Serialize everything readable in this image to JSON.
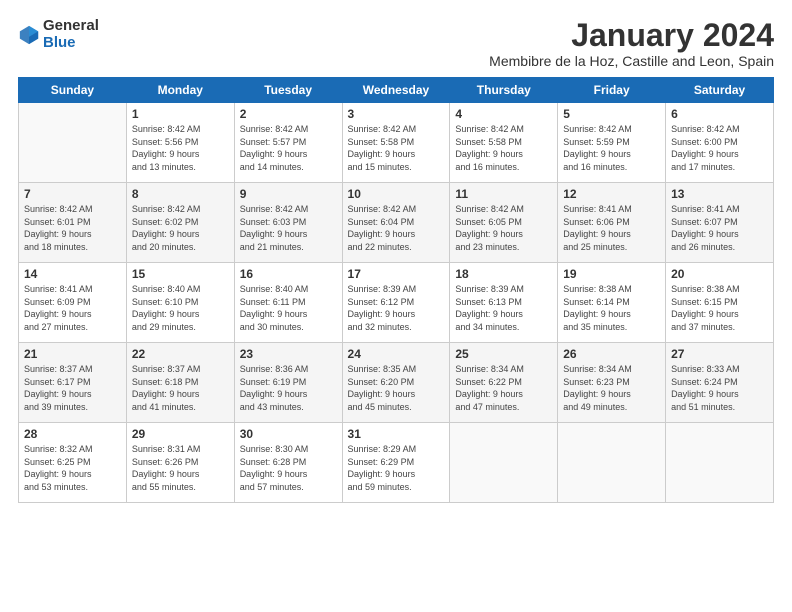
{
  "logo": {
    "general": "General",
    "blue": "Blue"
  },
  "title": "January 2024",
  "location": "Membibre de la Hoz, Castille and Leon, Spain",
  "headers": [
    "Sunday",
    "Monday",
    "Tuesday",
    "Wednesday",
    "Thursday",
    "Friday",
    "Saturday"
  ],
  "weeks": [
    [
      {
        "day": "",
        "text": ""
      },
      {
        "day": "1",
        "text": "Sunrise: 8:42 AM\nSunset: 5:56 PM\nDaylight: 9 hours\nand 13 minutes."
      },
      {
        "day": "2",
        "text": "Sunrise: 8:42 AM\nSunset: 5:57 PM\nDaylight: 9 hours\nand 14 minutes."
      },
      {
        "day": "3",
        "text": "Sunrise: 8:42 AM\nSunset: 5:58 PM\nDaylight: 9 hours\nand 15 minutes."
      },
      {
        "day": "4",
        "text": "Sunrise: 8:42 AM\nSunset: 5:58 PM\nDaylight: 9 hours\nand 16 minutes."
      },
      {
        "day": "5",
        "text": "Sunrise: 8:42 AM\nSunset: 5:59 PM\nDaylight: 9 hours\nand 16 minutes."
      },
      {
        "day": "6",
        "text": "Sunrise: 8:42 AM\nSunset: 6:00 PM\nDaylight: 9 hours\nand 17 minutes."
      }
    ],
    [
      {
        "day": "7",
        "text": "Sunrise: 8:42 AM\nSunset: 6:01 PM\nDaylight: 9 hours\nand 18 minutes."
      },
      {
        "day": "8",
        "text": "Sunrise: 8:42 AM\nSunset: 6:02 PM\nDaylight: 9 hours\nand 20 minutes."
      },
      {
        "day": "9",
        "text": "Sunrise: 8:42 AM\nSunset: 6:03 PM\nDaylight: 9 hours\nand 21 minutes."
      },
      {
        "day": "10",
        "text": "Sunrise: 8:42 AM\nSunset: 6:04 PM\nDaylight: 9 hours\nand 22 minutes."
      },
      {
        "day": "11",
        "text": "Sunrise: 8:42 AM\nSunset: 6:05 PM\nDaylight: 9 hours\nand 23 minutes."
      },
      {
        "day": "12",
        "text": "Sunrise: 8:41 AM\nSunset: 6:06 PM\nDaylight: 9 hours\nand 25 minutes."
      },
      {
        "day": "13",
        "text": "Sunrise: 8:41 AM\nSunset: 6:07 PM\nDaylight: 9 hours\nand 26 minutes."
      }
    ],
    [
      {
        "day": "14",
        "text": "Sunrise: 8:41 AM\nSunset: 6:09 PM\nDaylight: 9 hours\nand 27 minutes."
      },
      {
        "day": "15",
        "text": "Sunrise: 8:40 AM\nSunset: 6:10 PM\nDaylight: 9 hours\nand 29 minutes."
      },
      {
        "day": "16",
        "text": "Sunrise: 8:40 AM\nSunset: 6:11 PM\nDaylight: 9 hours\nand 30 minutes."
      },
      {
        "day": "17",
        "text": "Sunrise: 8:39 AM\nSunset: 6:12 PM\nDaylight: 9 hours\nand 32 minutes."
      },
      {
        "day": "18",
        "text": "Sunrise: 8:39 AM\nSunset: 6:13 PM\nDaylight: 9 hours\nand 34 minutes."
      },
      {
        "day": "19",
        "text": "Sunrise: 8:38 AM\nSunset: 6:14 PM\nDaylight: 9 hours\nand 35 minutes."
      },
      {
        "day": "20",
        "text": "Sunrise: 8:38 AM\nSunset: 6:15 PM\nDaylight: 9 hours\nand 37 minutes."
      }
    ],
    [
      {
        "day": "21",
        "text": "Sunrise: 8:37 AM\nSunset: 6:17 PM\nDaylight: 9 hours\nand 39 minutes."
      },
      {
        "day": "22",
        "text": "Sunrise: 8:37 AM\nSunset: 6:18 PM\nDaylight: 9 hours\nand 41 minutes."
      },
      {
        "day": "23",
        "text": "Sunrise: 8:36 AM\nSunset: 6:19 PM\nDaylight: 9 hours\nand 43 minutes."
      },
      {
        "day": "24",
        "text": "Sunrise: 8:35 AM\nSunset: 6:20 PM\nDaylight: 9 hours\nand 45 minutes."
      },
      {
        "day": "25",
        "text": "Sunrise: 8:34 AM\nSunset: 6:22 PM\nDaylight: 9 hours\nand 47 minutes."
      },
      {
        "day": "26",
        "text": "Sunrise: 8:34 AM\nSunset: 6:23 PM\nDaylight: 9 hours\nand 49 minutes."
      },
      {
        "day": "27",
        "text": "Sunrise: 8:33 AM\nSunset: 6:24 PM\nDaylight: 9 hours\nand 51 minutes."
      }
    ],
    [
      {
        "day": "28",
        "text": "Sunrise: 8:32 AM\nSunset: 6:25 PM\nDaylight: 9 hours\nand 53 minutes."
      },
      {
        "day": "29",
        "text": "Sunrise: 8:31 AM\nSunset: 6:26 PM\nDaylight: 9 hours\nand 55 minutes."
      },
      {
        "day": "30",
        "text": "Sunrise: 8:30 AM\nSunset: 6:28 PM\nDaylight: 9 hours\nand 57 minutes."
      },
      {
        "day": "31",
        "text": "Sunrise: 8:29 AM\nSunset: 6:29 PM\nDaylight: 9 hours\nand 59 minutes."
      },
      {
        "day": "",
        "text": ""
      },
      {
        "day": "",
        "text": ""
      },
      {
        "day": "",
        "text": ""
      }
    ]
  ]
}
